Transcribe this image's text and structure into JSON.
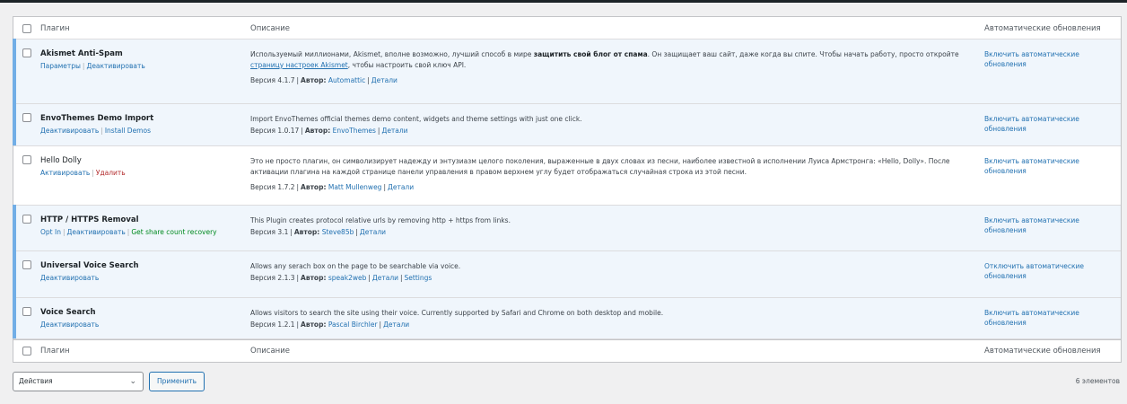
{
  "header": {
    "col_plugin": "Плагин",
    "col_description": "Описание",
    "col_auto": "Автоматические обновления"
  },
  "plugins": [
    {
      "name": "Akismet Anti-Spam",
      "actions": [
        "Параметры",
        "Деактивировать"
      ],
      "desc_part1": "Используемый миллионами, Akismet, вполне возможно, лучший способ в мире ",
      "desc_bold": "защитить свой блог от спама",
      "desc_part2": ". Он защищает ваш сайт, даже когда вы спите. Чтобы начать работу, просто откройте ",
      "desc_link": "страницу настроек Akismet",
      "desc_part3": ", чтобы настроить свой ключ API.",
      "version": "Версия 4.1.7",
      "author_label": "Автор:",
      "author": "Automattic",
      "details": "Детали",
      "auto": "Включить автоматические обновления"
    },
    {
      "name": "EnvoThemes Demo Import",
      "actions": [
        "Деактивировать",
        "Install Demos"
      ],
      "desc": "Import EnvoThemes official themes demo content, widgets and theme settings with just one click.",
      "version": "Версия 1.0.17",
      "author_label": "Автор:",
      "author": "EnvoThemes",
      "details": "Детали",
      "auto": "Включить автоматические обновления"
    },
    {
      "name": "Hello Dolly",
      "actions": [
        "Активировать",
        "Удалить"
      ],
      "desc": "Это не просто плагин, он символизирует надежду и энтузиазм целого поколения, выраженные в двух словах из песни, наиболее известной в исполнении Луиса Армстронга: «Hello, Dolly». После активации плагина на каждой странице панели управления в правом верхнем углу будет отображаться случайная строка из этой песни.",
      "version": "Версия 1.7.2",
      "author_label": "Автор:",
      "author": "Matt Mullenweg",
      "details": "Детали",
      "auto": "Включить автоматические обновления"
    },
    {
      "name": "HTTP / HTTPS Removal",
      "actions": [
        "Opt In",
        "Деактивировать",
        "Get share count recovery"
      ],
      "desc": "This Plugin creates protocol relative urls by removing http + https from links.",
      "version": "Версия 3.1",
      "author_label": "Автор:",
      "author": "Steve85b",
      "details": "Детали",
      "auto": "Включить автоматические обновления"
    },
    {
      "name": "Universal Voice Search",
      "actions": [
        "Деактивировать"
      ],
      "desc": "Allows any serach box on the page to be searchable via voice.",
      "version": "Версия 2.1.3",
      "author_label": "Автор:",
      "author": "speak2web",
      "details": "Детали",
      "settings": "Settings",
      "auto": "Отключить автоматические обновления"
    },
    {
      "name": "Voice Search",
      "actions": [
        "Деактивировать"
      ],
      "desc": "Allows visitors to search the site using their voice. Currently supported by Safari and Chrome on both desktop and mobile.",
      "version": "Версия 1.2.1",
      "author_label": "Автор:",
      "author": "Pascal Birchler",
      "details": "Детали",
      "auto": "Включить автоматические обновления"
    }
  ],
  "bulk": {
    "select_value": "Действия",
    "apply": "Применить",
    "count": "6 элементов"
  },
  "colors": {
    "active_border": "#72aee6",
    "active_bg": "#f0f6fc",
    "link": "#2271b1",
    "delete": "#b32d2e",
    "green": "#008a20"
  }
}
